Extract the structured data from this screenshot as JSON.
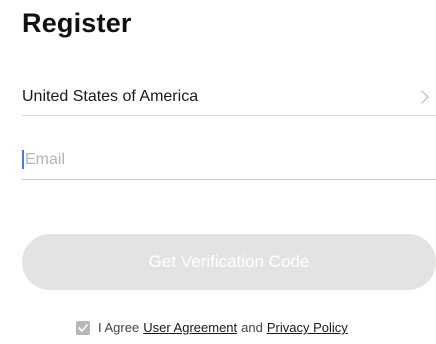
{
  "header": {
    "title": "Register"
  },
  "form": {
    "country": {
      "value": "United States of America",
      "icon": "chevron-right-icon"
    },
    "email": {
      "value": "",
      "placeholder": "Email"
    },
    "verify_button": {
      "label": "Get Verification Code",
      "state": "disabled"
    }
  },
  "agreement": {
    "checked": true,
    "prefix": "I Agree",
    "user_agreement": "User Agreement",
    "conjunction": "and",
    "privacy_policy": "Privacy Policy"
  },
  "colors": {
    "caret": "#3d7bf7",
    "button_disabled": "#e3e3e3",
    "checkbox": "#b8b8b8"
  }
}
